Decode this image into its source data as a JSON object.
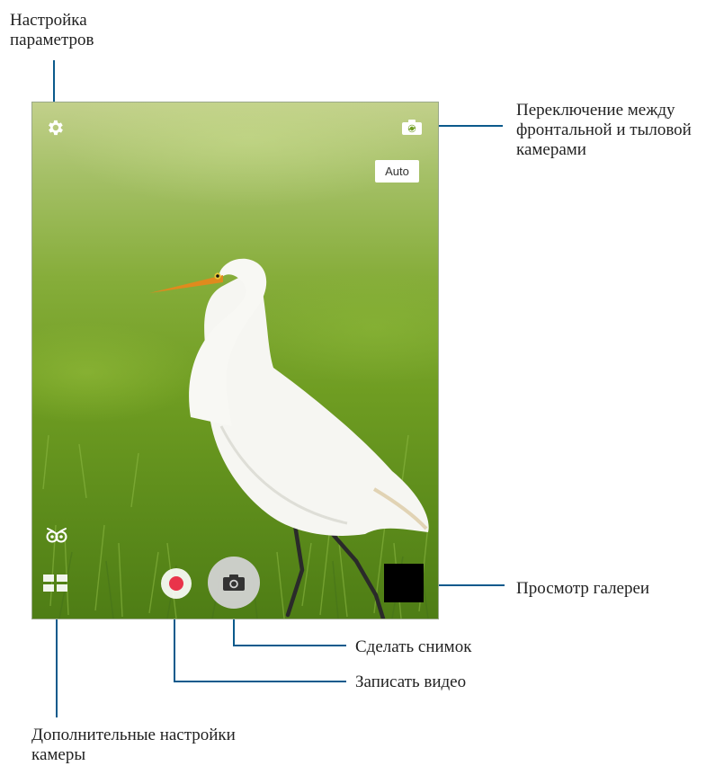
{
  "annotations": {
    "settings": [
      "Настройка",
      "параметров"
    ],
    "switch_camera": [
      "Переключение между",
      "фронтальной и тыловой",
      "камерами"
    ],
    "gallery": "Просмотр галереи",
    "take_photo": "Сделать снимок",
    "record_video": "Записать видео",
    "extra_settings": [
      "Дополнительные настройки",
      "камеры"
    ]
  },
  "camera_ui": {
    "mode_label": "Auto"
  },
  "colors": {
    "callout_line": "#0b5a8c",
    "record_dot": "#e9344a",
    "grass": "#6f9d22"
  },
  "icons": [
    "gear-icon",
    "switch-camera-icon",
    "owl-icon",
    "menu-icon",
    "record-icon",
    "camera-icon"
  ]
}
